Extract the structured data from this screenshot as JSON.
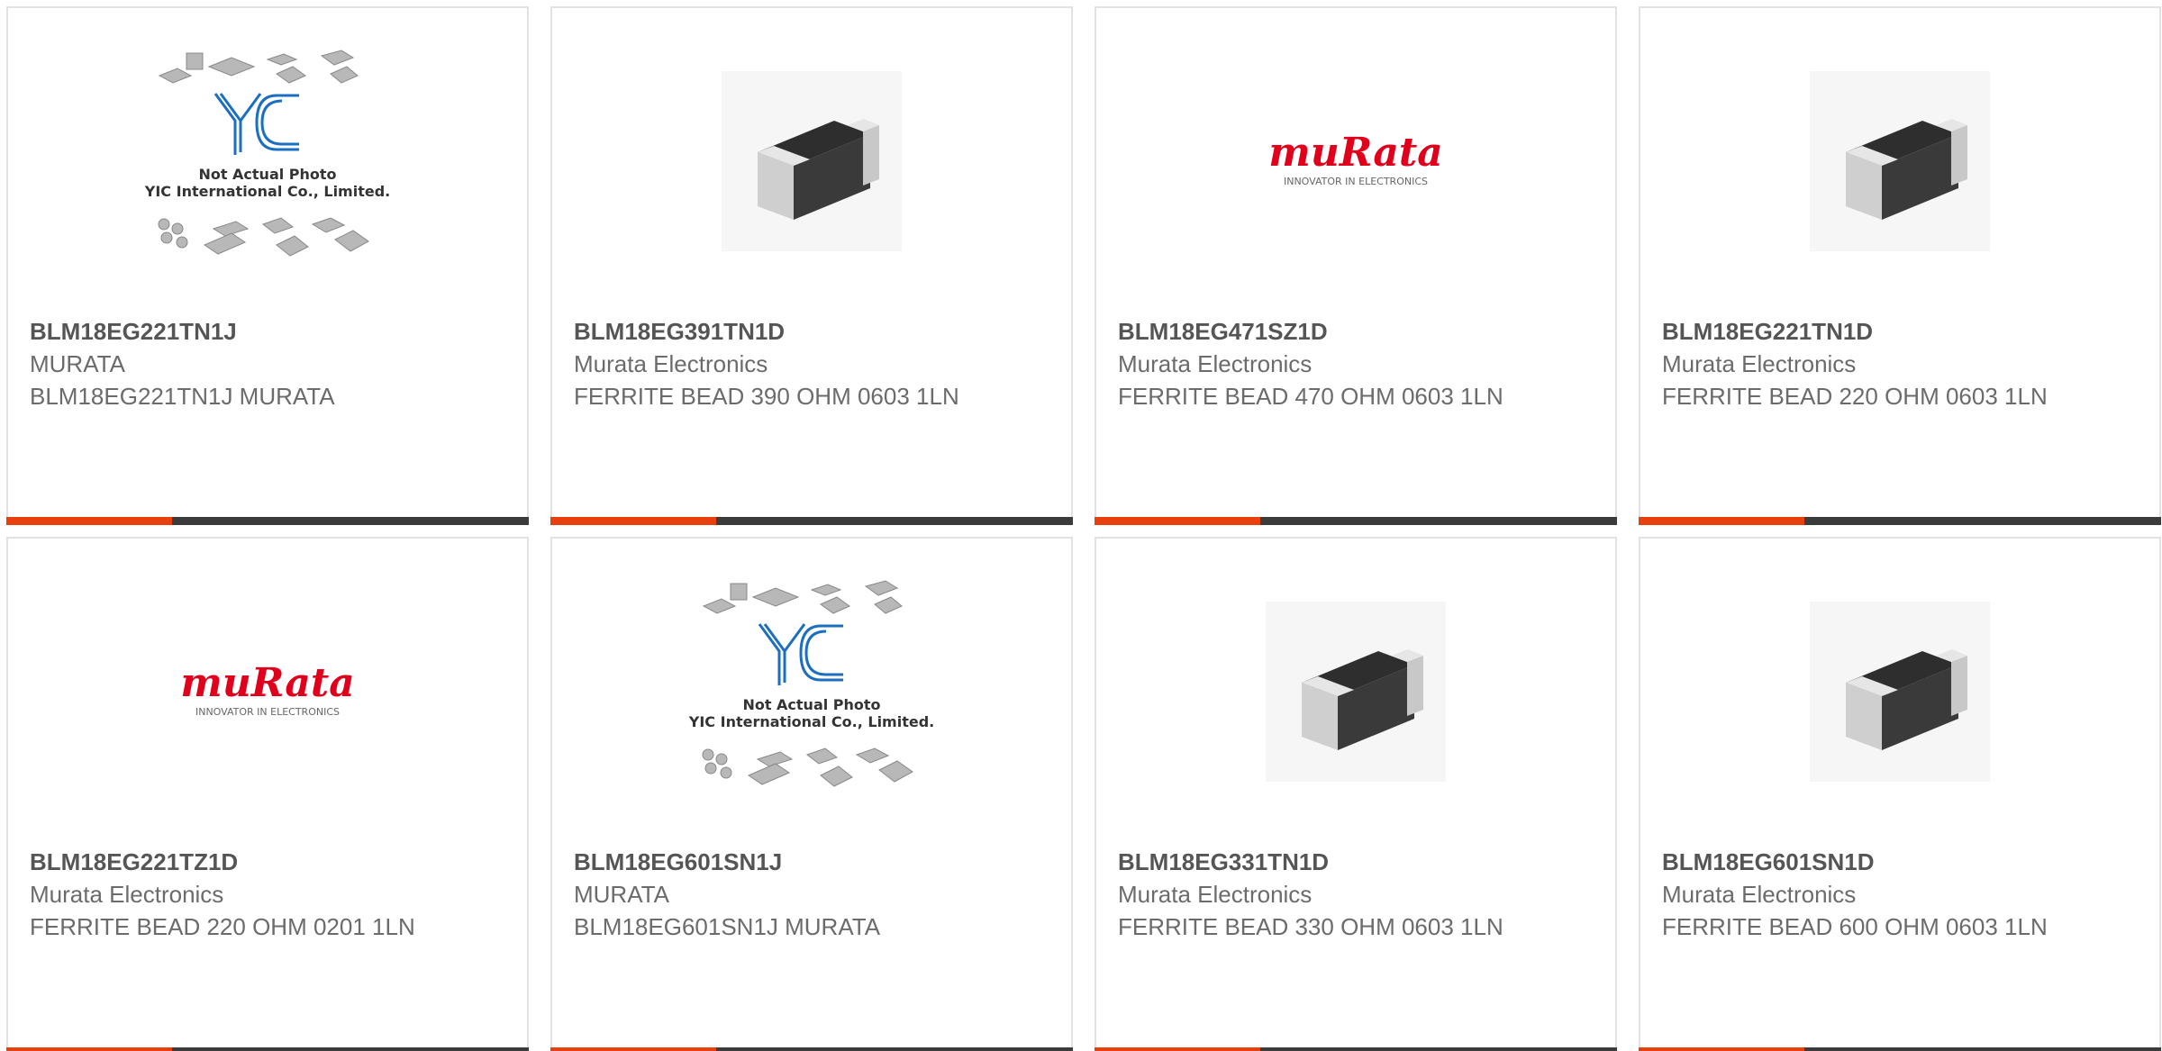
{
  "cards": [
    {
      "part": "BLM18EG221TN1J",
      "mfr": "MURATA",
      "desc": "BLM18EG221TN1J MURATA",
      "image": "yic-not-actual-photo",
      "yic_line1": "Not Actual Photo",
      "yic_line2": "YIC International Co., Limited."
    },
    {
      "part": "BLM18EG391TN1D",
      "mfr": "Murata Electronics",
      "desc": "FERRITE BEAD 390 OHM 0603 1LN",
      "image": "chip-photo"
    },
    {
      "part": "BLM18EG471SZ1D",
      "mfr": "Murata Electronics",
      "desc": "FERRITE BEAD 470 OHM 0603 1LN",
      "image": "murata-logo",
      "logo_text": "muRata",
      "logo_tagline": "INNOVATOR IN ELECTRONICS"
    },
    {
      "part": "BLM18EG221TN1D",
      "mfr": "Murata Electronics",
      "desc": "FERRITE BEAD 220 OHM 0603 1LN",
      "image": "chip-photo"
    },
    {
      "part": "BLM18EG221TZ1D",
      "mfr": "Murata Electronics",
      "desc": "FERRITE BEAD 220 OHM 0201 1LN",
      "image": "murata-logo",
      "logo_text": "muRata",
      "logo_tagline": "INNOVATOR IN ELECTRONICS"
    },
    {
      "part": "BLM18EG601SN1J",
      "mfr": "MURATA",
      "desc": "BLM18EG601SN1J MURATA",
      "image": "yic-not-actual-photo",
      "yic_line1": "Not Actual Photo",
      "yic_line2": "YIC International Co., Limited."
    },
    {
      "part": "BLM18EG331TN1D",
      "mfr": "Murata Electronics",
      "desc": "FERRITE BEAD 330 OHM 0603 1LN",
      "image": "chip-photo"
    },
    {
      "part": "BLM18EG601SN1D",
      "mfr": "Murata Electronics",
      "desc": "FERRITE BEAD 600 OHM 0603 1LN",
      "image": "chip-photo"
    }
  ],
  "colors": {
    "accent": "#e8400c",
    "bar_dark": "#3b3b3b",
    "murata_red": "#e0001b",
    "yic_blue": "#1c6fc0",
    "text": "#6b6b6b"
  }
}
